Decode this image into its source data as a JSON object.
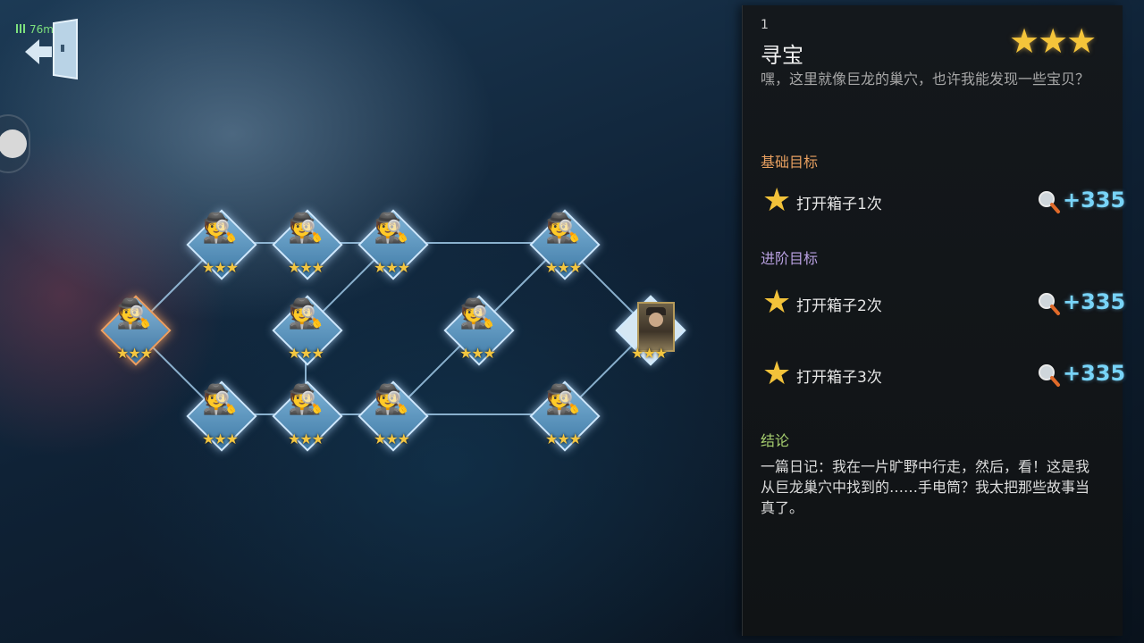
{
  "hud": {
    "ping": "76ms",
    "exit_icon": "exit-door-icon"
  },
  "map": {
    "nodes": [
      {
        "id": "n0",
        "glyph": "🕵",
        "stars": "★★★",
        "current": true
      },
      {
        "id": "n1",
        "glyph": "🕵",
        "stars": "★★★"
      },
      {
        "id": "n2",
        "glyph": "🕵",
        "stars": "★★★"
      },
      {
        "id": "n3",
        "glyph": "🕵",
        "stars": "★★★"
      },
      {
        "id": "n4",
        "glyph": "🕵",
        "stars": "★★★"
      },
      {
        "id": "n5",
        "glyph": "🕵",
        "stars": "★★★"
      },
      {
        "id": "n6",
        "glyph": "🕵",
        "stars": "★★★"
      },
      {
        "id": "n7",
        "glyph": "🕵",
        "stars": "★★★"
      },
      {
        "id": "n8",
        "glyph": "🕵",
        "stars": "★★★"
      },
      {
        "id": "n9",
        "glyph": "🕵",
        "stars": "★★★"
      },
      {
        "id": "n10",
        "glyph": "🕵",
        "stars": "★★★"
      },
      {
        "id": "n11",
        "glyph": "🕵",
        "stars": "★★★"
      },
      {
        "id": "boss",
        "stars": "★★★",
        "boss": true
      }
    ]
  },
  "panel": {
    "number": "1",
    "title": "寻宝",
    "rating": "★★★",
    "description": "嘿，这里就像巨龙的巢穴，也许我能发现一些宝贝？",
    "basic_heading": "基础目标",
    "basic_goals": [
      {
        "text": "打开箱子1次",
        "reward": "+335"
      }
    ],
    "advanced_heading": "进阶目标",
    "advanced_goals": [
      {
        "text": "打开箱子2次",
        "reward": "+335"
      },
      {
        "text": "打开箱子3次",
        "reward": "+335"
      }
    ],
    "conclusion_heading": "结论",
    "conclusion": "一篇日记：我在一片旷野中行走，然后，看！这是我从巨龙巢穴中找到的……手电筒？我太把那些故事当真了。",
    "reward_icon": "magnifier-icon",
    "colors": {
      "reward": "#78d4f8",
      "star": "#f2c23a",
      "basic": "#e8a060",
      "advanced": "#b8a0e0",
      "conclusion": "#a8d070"
    }
  }
}
